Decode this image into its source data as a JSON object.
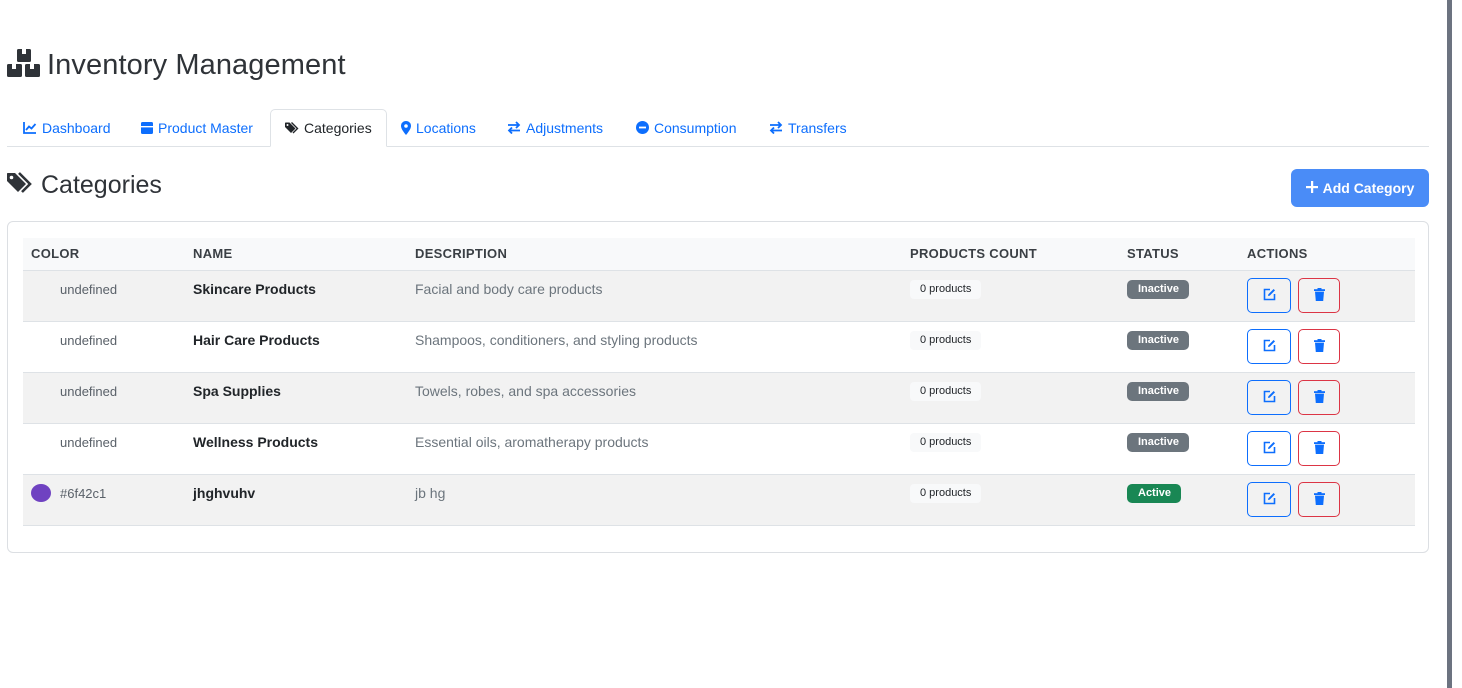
{
  "app": {
    "title": "Inventory Management"
  },
  "tabs": [
    {
      "label": "Dashboard",
      "icon": "chart-line-icon"
    },
    {
      "label": "Product Master",
      "icon": "boxes-icon"
    },
    {
      "label": "Categories",
      "icon": "tags-icon",
      "active": true
    },
    {
      "label": "Locations",
      "icon": "map-marker-icon"
    },
    {
      "label": "Adjustments",
      "icon": "exchange-icon"
    },
    {
      "label": "Consumption",
      "icon": "minus-circle-icon"
    },
    {
      "label": "Transfers",
      "icon": "exchange-icon"
    }
  ],
  "section": {
    "title": "Categories",
    "add_label": "Add Category"
  },
  "table": {
    "headers": [
      "COLOR",
      "NAME",
      "DESCRIPTION",
      "PRODUCTS COUNT",
      "STATUS",
      "ACTIONS"
    ],
    "rows": [
      {
        "color_text": "undefined",
        "swatch": "",
        "name": "Skincare Products",
        "description": "Facial and body care products",
        "count": "0 products",
        "status": "Inactive"
      },
      {
        "color_text": "undefined",
        "swatch": "",
        "name": "Hair Care Products",
        "description": "Shampoos, conditioners, and styling products",
        "count": "0 products",
        "status": "Inactive"
      },
      {
        "color_text": "undefined",
        "swatch": "",
        "name": "Spa Supplies",
        "description": "Towels, robes, and spa accessories",
        "count": "0 products",
        "status": "Inactive"
      },
      {
        "color_text": "undefined",
        "swatch": "",
        "name": "Wellness Products",
        "description": "Essential oils, aromatherapy products",
        "count": "0 products",
        "status": "Inactive"
      },
      {
        "color_text": "#6f42c1",
        "swatch": "#6f42c1",
        "name": "jhghvuhv",
        "description": "jb hg",
        "count": "0 products",
        "status": "Active"
      }
    ]
  },
  "colors": {
    "primary": "#0d6efd",
    "add_button": "#4a8cf7",
    "danger": "#dc3545",
    "inactive_badge": "#6c757d",
    "active_badge": "#198754"
  }
}
